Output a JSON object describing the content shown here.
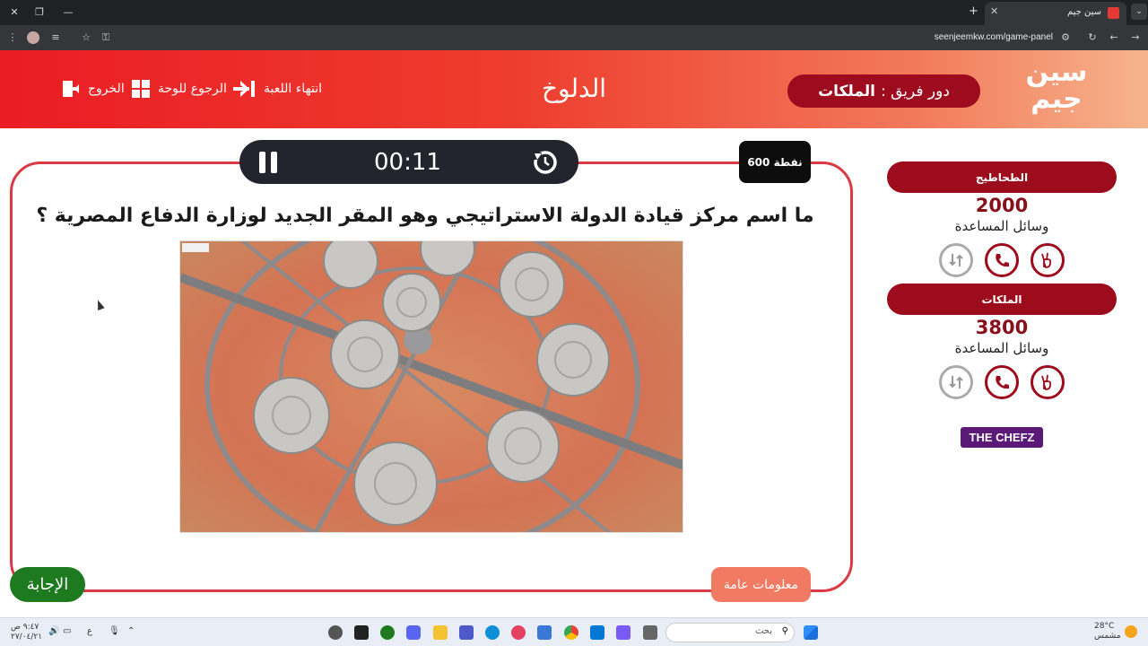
{
  "browser": {
    "tab_title": "سين جيم",
    "url": "seenjeemkw.com/game-panel"
  },
  "header": {
    "logo_text": "سين جيم",
    "turn_prefix": "دور فريق :",
    "turn_team": "الملكات",
    "game_title": "الدلوخ",
    "nav": {
      "end_game": "انتهاء اللعبة",
      "back_board": "الرجوع للوحة",
      "exit": "الخروج"
    }
  },
  "question": {
    "points": "600 نقطة",
    "timer": "00:11",
    "text": "ما اسم مركز قيادة الدولة الاستراتيجي وهو المقر الجديد لوزارة الدفاع المصرية ؟",
    "category": "معلومات عامة",
    "answer_button": "الإجابة"
  },
  "teams": [
    {
      "name": "الطحاطيج",
      "score": "2000",
      "aids_label": "وسائل المساعدة"
    },
    {
      "name": "الملكات",
      "score": "3800",
      "aids_label": "وسائل المساعدة"
    }
  ],
  "sponsor": "THE CHEFZ",
  "taskbar": {
    "search_label": "بحث",
    "weather_temp": "28°C",
    "weather_desc": "مشمس",
    "time": "٩:٤٧ ص",
    "date": "٢٧/٠٤/٢١",
    "lang": "ع"
  },
  "colors": {
    "header_start": "#ea1c24",
    "header_end": "#f6b48c",
    "team_bar": "#9d0c1c",
    "card_border": "#d93a46",
    "answer_button": "#1e7a1e",
    "category": "#f07b62"
  }
}
